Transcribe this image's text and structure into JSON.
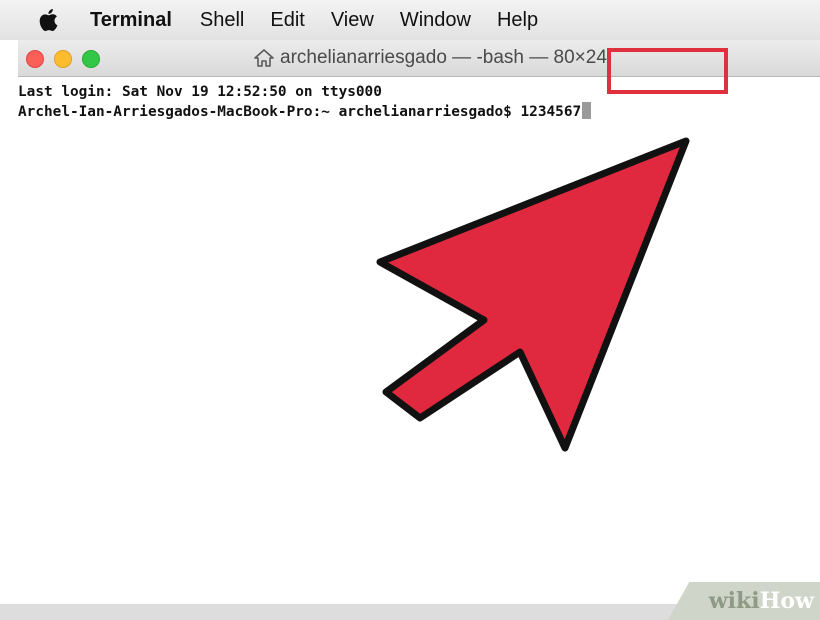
{
  "menubar": {
    "apple_icon": "apple-logo",
    "items": [
      "Terminal",
      "Shell",
      "Edit",
      "View",
      "Window",
      "Help"
    ]
  },
  "window": {
    "title": "archelianarriesgado — -bash — 80×24",
    "title_icon": "home-icon",
    "traffic_lights": {
      "close": "#fc5f57",
      "minimize": "#fdbc2e",
      "zoom": "#33c748"
    }
  },
  "terminal": {
    "lines": [
      "Last login: Sat Nov 19 12:52:50 on ttys000",
      "Archel-Ian-Arriesgados-MacBook-Pro:~ archelianarriesgado$ "
    ],
    "typed_input": "1234567"
  },
  "annotation": {
    "highlight_color": "#e0303e",
    "arrow_color": "#e0293f",
    "arrow_icon": "pointer-arrow"
  },
  "watermark": {
    "wiki": "wiki",
    "how": "How"
  }
}
